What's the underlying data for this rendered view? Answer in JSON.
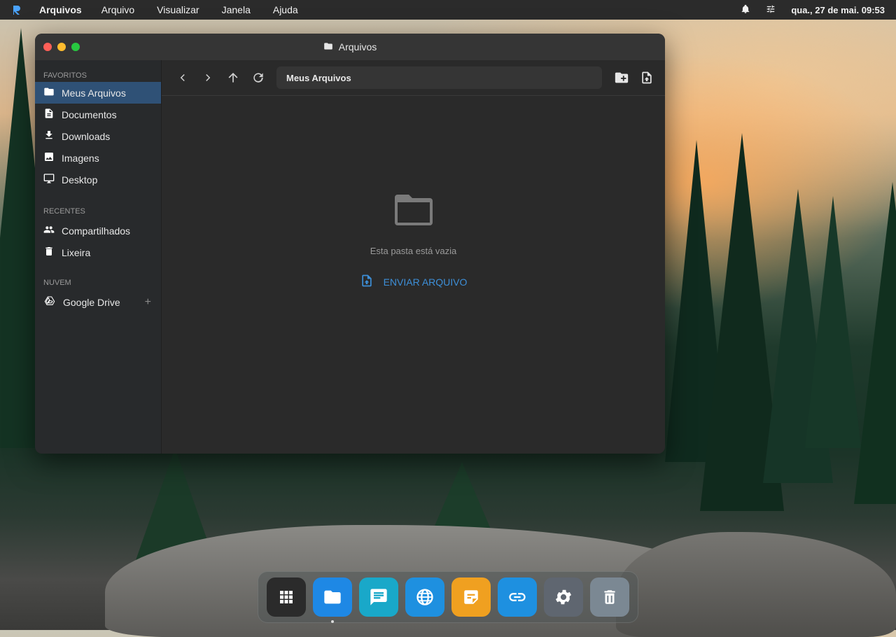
{
  "menubar": {
    "app_name": "Arquivos",
    "items": [
      "Arquivo",
      "Visualizar",
      "Janela",
      "Ajuda"
    ],
    "clock": "qua., 27 de mai. 09:53",
    "icons": [
      "bell-icon",
      "sliders-icon"
    ]
  },
  "window": {
    "title": "Arquivos",
    "traffic_colors": [
      "#ff5f57",
      "#febc2e",
      "#28c840"
    ]
  },
  "sidebar": {
    "sections": [
      {
        "title": "Favoritos",
        "items": [
          {
            "label": "Meus Arquivos",
            "icon": "folder-icon",
            "active": true
          },
          {
            "label": "Documentos",
            "icon": "document-icon"
          },
          {
            "label": "Downloads",
            "icon": "download-icon"
          },
          {
            "label": "Imagens",
            "icon": "image-icon"
          },
          {
            "label": "Desktop",
            "icon": "monitor-icon"
          }
        ]
      },
      {
        "title": "Recentes",
        "items": [
          {
            "label": "Compartilhados",
            "icon": "people-icon"
          },
          {
            "label": "Lixeira",
            "icon": "trash-icon"
          }
        ]
      },
      {
        "title": "Nuvem",
        "items": [
          {
            "label": "Google Drive",
            "icon": "google-drive-icon",
            "add": "+"
          }
        ]
      }
    ]
  },
  "toolbar": {
    "path": "Meus Arquivos"
  },
  "empty_state": {
    "message": "Esta pasta está vazia",
    "upload_label": "ENVIAR ARQUIVO"
  },
  "dock": {
    "apps": [
      {
        "name": "app-grid-icon",
        "color": "#2b2b2b"
      },
      {
        "name": "files-icon",
        "color": "#1e88e5",
        "running": true
      },
      {
        "name": "chat-icon",
        "color": "#19a8c9"
      },
      {
        "name": "globe-icon",
        "color": "#1e90e0"
      },
      {
        "name": "notes-icon",
        "color": "#f0a020"
      },
      {
        "name": "link-icon",
        "color": "#1e90e0"
      },
      {
        "name": "settings-icon",
        "color": "#5f6670"
      },
      {
        "name": "trash-icon",
        "color": "#7b8893"
      }
    ]
  },
  "colors": {
    "accent": "#3d8fd8",
    "sidebar_active": "#2f5176"
  }
}
